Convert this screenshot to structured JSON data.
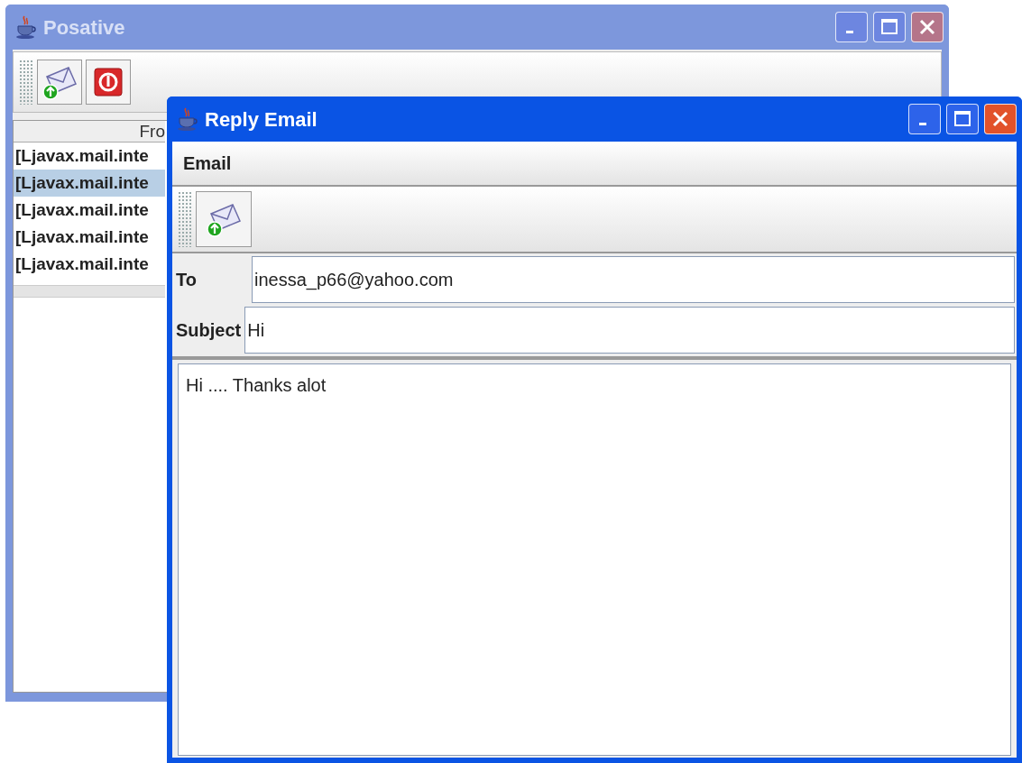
{
  "main_window": {
    "title": "Posative",
    "active": false,
    "toolbar": [
      {
        "kind": "send"
      },
      {
        "kind": "power"
      }
    ],
    "table": {
      "columns": [
        "Fro"
      ],
      "rows": [
        {
          "cells": [
            "[Ljavax.mail.inte"
          ],
          "selected": false
        },
        {
          "cells": [
            "[Ljavax.mail.inte"
          ],
          "selected": true
        },
        {
          "cells": [
            "[Ljavax.mail.inte"
          ],
          "selected": false
        },
        {
          "cells": [
            "[Ljavax.mail.inte"
          ],
          "selected": false
        },
        {
          "cells": [
            "[Ljavax.mail.inte"
          ],
          "selected": false
        }
      ]
    }
  },
  "reply_window": {
    "title": "Reply Email",
    "active": true,
    "menu": [
      "Email"
    ],
    "toolbar": [
      {
        "kind": "send"
      }
    ],
    "fields": [
      {
        "label": "To",
        "value": "inessa_p66@yahoo.com"
      },
      {
        "label": "Subject",
        "value": "Hi"
      }
    ],
    "body": "Hi .... Thanks alot"
  }
}
